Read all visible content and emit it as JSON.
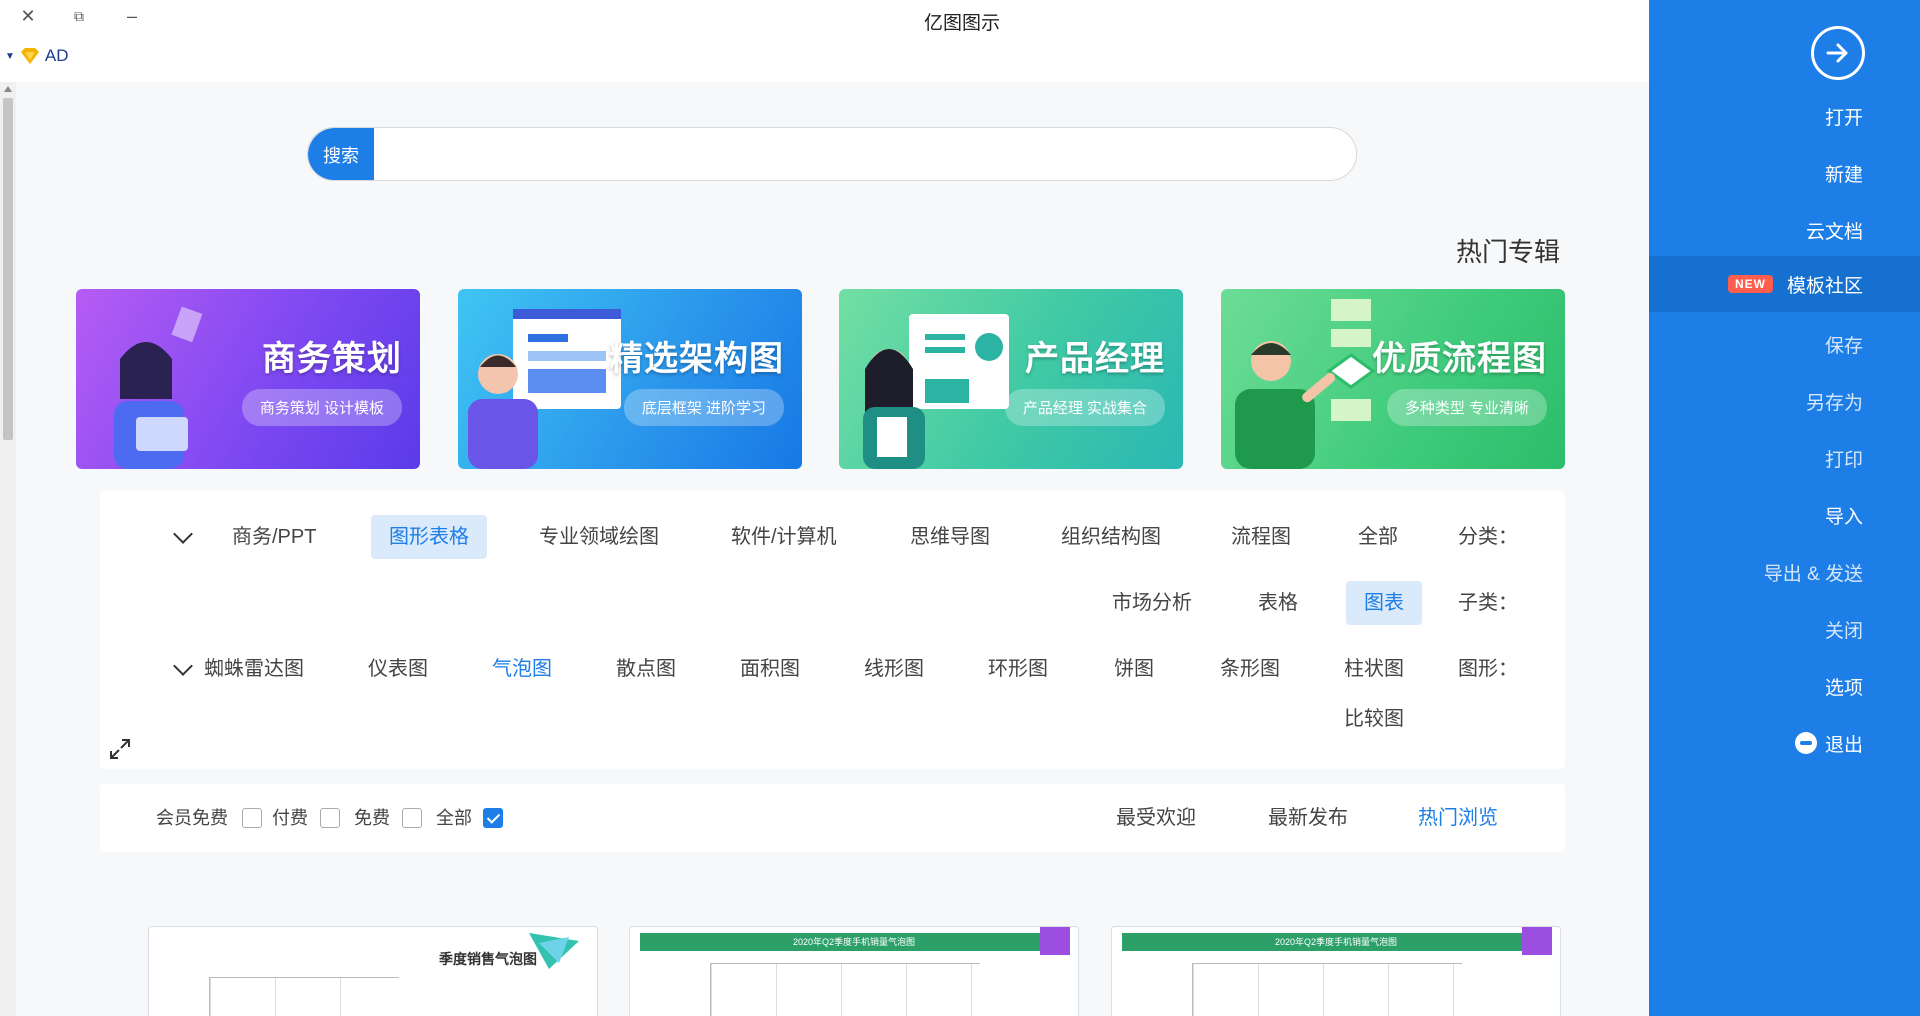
{
  "window": {
    "title": "亿图图示",
    "close_glyph": "✕",
    "restore_glyph": "⧉",
    "minimize_glyph": "–",
    "account_label": "AD"
  },
  "sidebar": {
    "items": [
      {
        "label": "打开"
      },
      {
        "label": "新建"
      },
      {
        "label": "云文档"
      },
      {
        "label": "模板社区",
        "badge": "NEW"
      },
      {
        "label": "保存"
      },
      {
        "label": "另存为"
      },
      {
        "label": "打印"
      },
      {
        "label": "导入"
      },
      {
        "label": "导出 & 发送"
      },
      {
        "label": "关闭"
      },
      {
        "label": "选项"
      },
      {
        "label": "退出"
      }
    ]
  },
  "search": {
    "button_label": "搜索",
    "value": ""
  },
  "hot_section": {
    "title": "热门专辑",
    "banners": [
      {
        "title": "商务策划",
        "subtitle": "商务策划 设计模板"
      },
      {
        "title": "精选架构图",
        "subtitle": "底层框架 进阶学习"
      },
      {
        "title": "产品经理",
        "subtitle": "产品经理 实战集合"
      },
      {
        "title": "优质流程图",
        "subtitle": "多种类型 专业清晰"
      }
    ]
  },
  "filters": {
    "category_label": "分类：",
    "categories": [
      "全部",
      "流程图",
      "组织结构图",
      "思维导图",
      "软件/计算机",
      "专业领域绘图",
      "图形表格",
      "商务/PPT"
    ],
    "selected_category": "图形表格",
    "subcategory_label": "子类：",
    "subcategories": [
      "图表",
      "表格",
      "市场分析"
    ],
    "selected_subcategory": "图表",
    "shape_label": "图形：",
    "shapes": [
      "柱状图",
      "条形图",
      "饼图",
      "环形图",
      "线形图",
      "面积图",
      "散点图",
      "气泡图",
      "仪表图",
      "蜘蛛雷达图",
      "比较图"
    ],
    "selected_shape": "气泡图"
  },
  "sort": {
    "tabs": [
      "热门浏览",
      "最新发布",
      "最受欢迎"
    ],
    "active_tab": "热门浏览",
    "price_filters": [
      {
        "label": "全部",
        "checked": true
      },
      {
        "label": "免费",
        "checked": false
      },
      {
        "label": "付费",
        "checked": false
      },
      {
        "label": "会员免费",
        "checked": false
      }
    ]
  },
  "templates": [
    {
      "title": "季度销售气泡图"
    },
    {
      "title": "2020年Q2季度手机销量气泡图"
    },
    {
      "title": "2020年Q2季度手机销量气泡图"
    }
  ],
  "colors": {
    "accent": "#1c7ee6",
    "sidebar_bg": "#1c7ee6",
    "new_badge": "#ff5d4d"
  }
}
